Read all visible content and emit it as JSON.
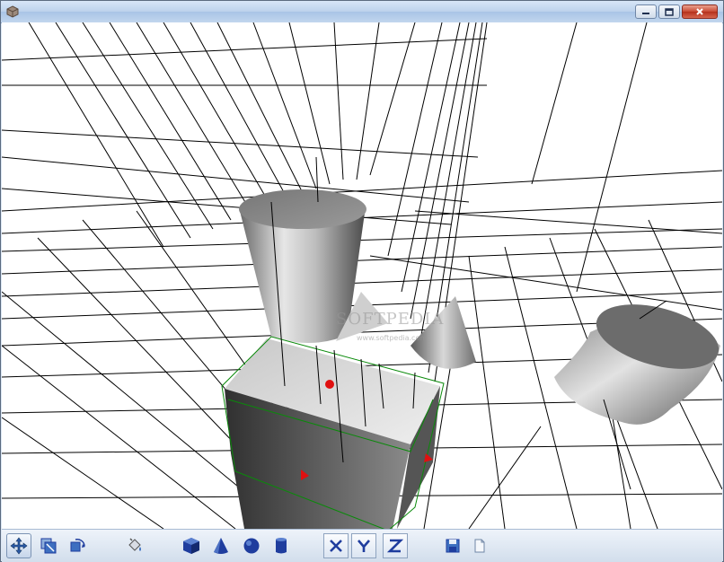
{
  "window": {
    "icons": {
      "app": "app-icon",
      "minimize": "minimize-icon",
      "maximize": "maximize-icon",
      "close": "close-icon"
    }
  },
  "viewport": {
    "watermark": "SOFTPEDIA",
    "watermark_sub": "www.softpedia.com",
    "objects": [
      "cylinder",
      "cone",
      "box",
      "cylinder"
    ]
  },
  "toolbar": {
    "tools": [
      {
        "name": "move-icon",
        "active": true
      },
      {
        "name": "scale-icon",
        "active": false
      },
      {
        "name": "rotate-icon",
        "active": false
      },
      {
        "name": "paint-bucket-icon",
        "active": false
      }
    ],
    "primitives": [
      "cube-icon",
      "cone-icon",
      "sphere-icon",
      "cylinder-icon"
    ],
    "axes": [
      "X",
      "Y",
      "Z"
    ],
    "file": [
      "save-icon",
      "new-file-icon"
    ]
  },
  "colors": {
    "accent": "#1f3d9e",
    "selection": "#0a8a0a",
    "gizmo": "#e01010"
  }
}
